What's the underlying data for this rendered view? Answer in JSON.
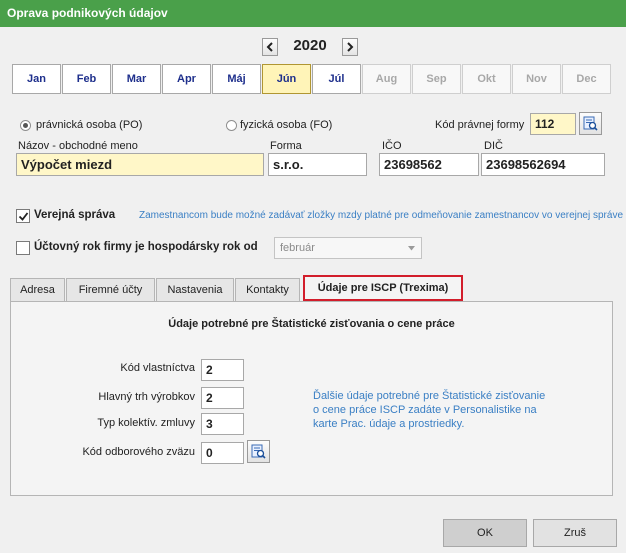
{
  "window": {
    "title": "Oprava podnikových údajov"
  },
  "year": {
    "value": "2020"
  },
  "months": [
    {
      "label": "Jan",
      "state": "normal"
    },
    {
      "label": "Feb",
      "state": "normal"
    },
    {
      "label": "Mar",
      "state": "normal"
    },
    {
      "label": "Apr",
      "state": "normal"
    },
    {
      "label": "Máj",
      "state": "normal"
    },
    {
      "label": "Jún",
      "state": "active"
    },
    {
      "label": "Júl",
      "state": "normal"
    },
    {
      "label": "Aug",
      "state": "disabled"
    },
    {
      "label": "Sep",
      "state": "disabled"
    },
    {
      "label": "Okt",
      "state": "disabled"
    },
    {
      "label": "Nov",
      "state": "disabled"
    },
    {
      "label": "Dec",
      "state": "disabled"
    }
  ],
  "entity": {
    "legal_label": "právnická osoba (PO)",
    "natural_label": "fyzická osoba (FO)",
    "selected": "legal",
    "legal_form_code_label": "Kód právnej formy",
    "legal_form_code": "112"
  },
  "company": {
    "name_label": "Názov - obchodné meno",
    "name": "Výpočet miezd",
    "form_label": "Forma",
    "form": "s.r.o.",
    "ico_label": "IČO",
    "ico": "23698562",
    "dic_label": "DIČ",
    "dic": "23698562694"
  },
  "public_admin": {
    "label": "Verejná správa",
    "checked": true,
    "note": "Zamestnancom bude možné zadávať zložky mzdy platné pre odmeňovanie zamestnancov vo verejnej správe"
  },
  "fiscal_year": {
    "label": "Účtovný rok firmy je hospodársky rok od",
    "checked": false,
    "month": "február"
  },
  "tabs": [
    {
      "label": "Adresa"
    },
    {
      "label": "Firemné účty"
    },
    {
      "label": "Nastavenia"
    },
    {
      "label": "Kontakty"
    },
    {
      "label": "Údaje pre ISCP (Trexima)",
      "active": true
    }
  ],
  "iscp": {
    "heading": "Údaje potrebné pre Štatistické zisťovania o cene práce",
    "fields": [
      {
        "label": "Kód vlastníctva",
        "value": "2"
      },
      {
        "label": "Hlavný trh výrobkov",
        "value": "2"
      },
      {
        "label": "Typ kolektív. zmluvy",
        "value": "3"
      },
      {
        "label": "Kód odborového zväzu",
        "value": "0"
      }
    ],
    "info_lines": [
      "Ďalšie údaje potrebné pre Štatistické zisťovanie",
      "o cene práce ISCP zadáte v Personalistike na",
      "karte Prac. údaje a prostriedky."
    ]
  },
  "buttons": {
    "ok": "OK",
    "cancel": "Zruš"
  },
  "colors": {
    "titlebar": "#4aa04a",
    "active_month": "#fff4b8",
    "tab_highlight": "#d21d2b",
    "note": "#3a7fc4"
  }
}
